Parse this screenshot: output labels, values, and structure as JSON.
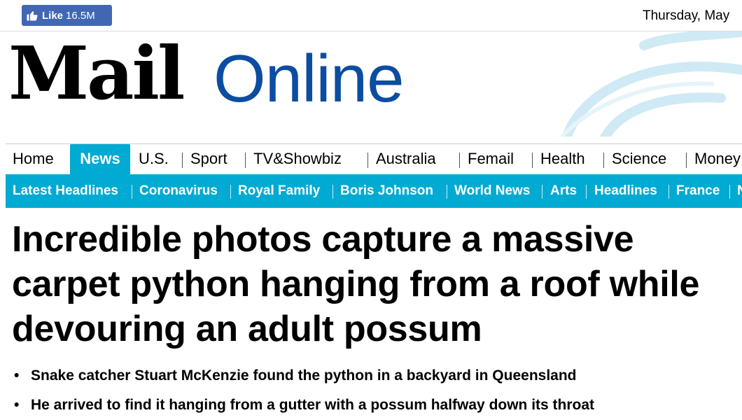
{
  "topbar": {
    "like_label": "Like",
    "like_count": "16.5M",
    "date": "Thursday, May"
  },
  "masthead": {
    "logo_mail": "Mail",
    "logo_online": "Online"
  },
  "nav": {
    "items": [
      "Home",
      "News",
      "U.S.",
      "Sport",
      "TV&Showbiz",
      "Australia",
      "Femail",
      "Health",
      "Science",
      "Money"
    ],
    "active": "News"
  },
  "subnav": {
    "items": [
      "Latest Headlines",
      "Coronavirus",
      "Royal Family",
      "Boris Johnson",
      "World News",
      "Arts",
      "Headlines",
      "France",
      "N"
    ]
  },
  "article": {
    "headline": "Incredible photos capture a massive carpet python hanging from a roof while devouring an adult possum",
    "bullets": [
      "Snake catcher Stuart McKenzie found the python in a backyard in Queensland",
      "He arrived to find it hanging from a gutter with a possum halfway down its throat"
    ]
  },
  "colors": {
    "accent": "#00aad2",
    "facebook": "#4267b2",
    "logo_online": "#0c4da2"
  }
}
